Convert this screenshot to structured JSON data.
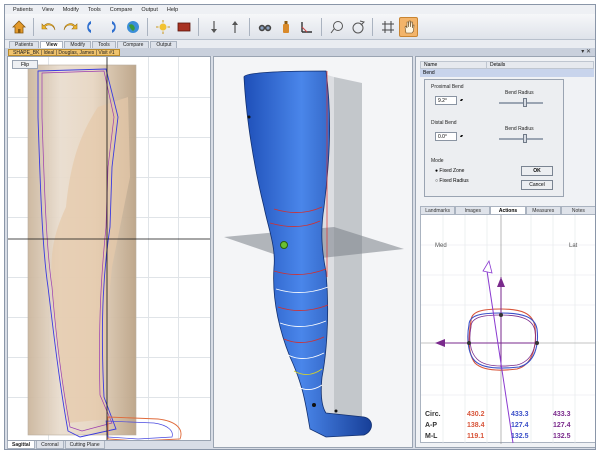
{
  "menu": [
    "Patients",
    "View",
    "Modify",
    "Tools",
    "Compare",
    "Output",
    "Help"
  ],
  "toolbar": {
    "icons": [
      "home-icon",
      "undo-icon",
      "redo-icon",
      "rotate-icon",
      "globe-icon",
      "sun-icon",
      "measure-box-icon",
      "down-arrow-icon",
      "up-arrow-icon",
      "binoculars-icon",
      "bottle-icon",
      "angle-icon",
      "lasso-icon",
      "circle-arrow-icon",
      "grid-icon",
      "hand-icon"
    ]
  },
  "main_tabs": [
    "Patients",
    "View",
    "Modify",
    "Tools",
    "Compare",
    "Output"
  ],
  "main_tab_active": "View",
  "document_tab": "SHAPE_BK | Ideal | Douglas, James | Visit #1",
  "left_pane": {
    "flip_label": "Flip",
    "view_tabs": [
      "Sagittal",
      "Coronal",
      "Cutting Plane"
    ],
    "view_tab_active": "Sagittal"
  },
  "properties": {
    "col_name": "Name",
    "col_details": "Details",
    "row": "Bend",
    "dialog": {
      "proximal_group": "Proximal Bend",
      "proximal_value": "9.2°",
      "proximal_radius_label": "Bend Radius",
      "distal_group": "Distal Bend",
      "distal_value": "0.0°",
      "distal_radius_label": "Bend Radius",
      "mode_group": "Mode",
      "mode_options": [
        "Fixed Zone",
        "Fixed Radius"
      ],
      "mode_selected": "Fixed Zone",
      "ok_label": "OK",
      "cancel_label": "Cancel"
    }
  },
  "right_tabs": [
    "Landmarks",
    "Images",
    "Actions",
    "Measures",
    "Notes"
  ],
  "right_tab_active": "Actions",
  "cross_section": {
    "med_label": "Med",
    "lat_label": "Lat",
    "colors": {
      "red": "#d8553a",
      "blue": "#3a4fc8",
      "purple": "#7a2a8c"
    }
  },
  "measurements": [
    {
      "label": "Circ.",
      "values": [
        "430.2",
        "433.3",
        "433.3"
      ]
    },
    {
      "label": "A-P",
      "values": [
        "138.4",
        "127.4",
        "127.4"
      ]
    },
    {
      "label": "M-L",
      "values": [
        "119.1",
        "132.5",
        "132.5"
      ]
    }
  ]
}
